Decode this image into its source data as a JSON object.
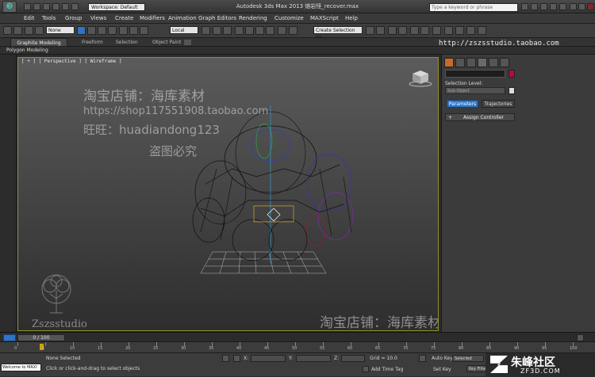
{
  "titlebar": {
    "workspace": "Workspace: Default",
    "window_title": "Autodesk 3ds Max  2013    熔岩怪_recover.max",
    "search_placeholder": "Type a keyword or phrase"
  },
  "menu": [
    "Edit",
    "Tools",
    "Group",
    "Views",
    "Create",
    "Modifiers",
    "Animation",
    "Graph Editors",
    "Rendering",
    "Customize",
    "MAXScript",
    "Help"
  ],
  "toolbar": {
    "selection_filter": "None",
    "reference_coord": "Local",
    "named_selection": "Create Selection Se"
  },
  "ribbon": {
    "tabs": [
      "Graphite Modeling Tools",
      "Freeform",
      "Selection",
      "Object Paint"
    ],
    "panel_label": "Polygon Modeling"
  },
  "viewport": {
    "label": "[ + ] [ Perspective ] [ Wireframe ]"
  },
  "command_panel": {
    "selection_level_label": "Selection Level:",
    "sub_object": "Sub-Object",
    "tab_parameters": "Parameters",
    "tab_trajectories": "Trajectories",
    "rollout_assign": "Assign Controller"
  },
  "timeline": {
    "frame_counter": "0 / 100",
    "ticks": [
      "0",
      "5",
      "10",
      "15",
      "20",
      "25",
      "30",
      "35",
      "40",
      "45",
      "50",
      "55",
      "60",
      "65",
      "70",
      "75",
      "80",
      "85",
      "90",
      "95",
      "100"
    ]
  },
  "status": {
    "selected": "None Selected",
    "prompt": "Click or click-and-drag to select objects",
    "maxscript": "Welcome to MAXI",
    "x_label": "X:",
    "y_label": "Y:",
    "z_label": "Z:",
    "grid": "Grid = 10.0",
    "add_time_tag": "Add Time Tag",
    "auto_key": "Auto Key",
    "selected_label": "Selected",
    "set_key": "Set Key",
    "key_filters": "Key Filters..."
  },
  "watermarks": {
    "shop_cn": "淘宝店铺：海库素材",
    "shop_url": "https://shop117551908.taobao.com",
    "wangwang": "旺旺：huadiandong123",
    "no_theft": "盗图必究",
    "top_url": "http://zszsstudio.taobao.com",
    "studio": "Zszsstudio",
    "site_cn": "朱峰社区",
    "site_url": "ZF3D.COM"
  },
  "colors": {
    "selection_blue": "#2f74c6",
    "object_color": "#b40d3a",
    "viewport_border": "#8f8f28"
  }
}
